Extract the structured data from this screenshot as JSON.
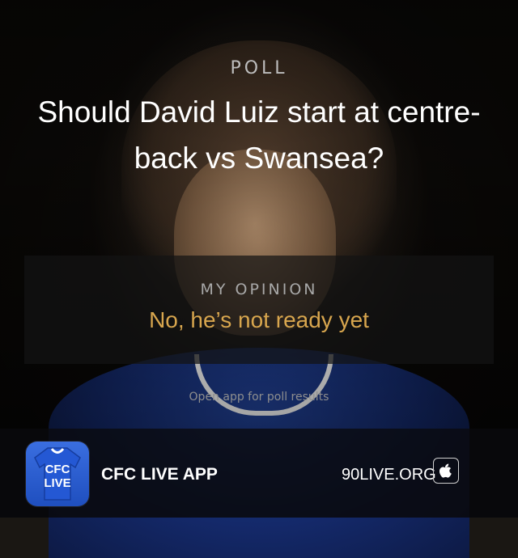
{
  "poll": {
    "label": "POLL",
    "question": "Should David Luiz start at centre-back vs Swansea?"
  },
  "opinion": {
    "label": "MY OPINION",
    "answer": "No, he’s not ready yet"
  },
  "note": "Open app for poll results",
  "footer": {
    "app_icon_text": "CFC\nLIVE",
    "app_name": "CFC LIVE APP",
    "site": "90LIVE.ORG",
    "store_icon": "apple-icon"
  },
  "colors": {
    "answer": "#d8a64e",
    "app_icon": "#2458d4"
  }
}
